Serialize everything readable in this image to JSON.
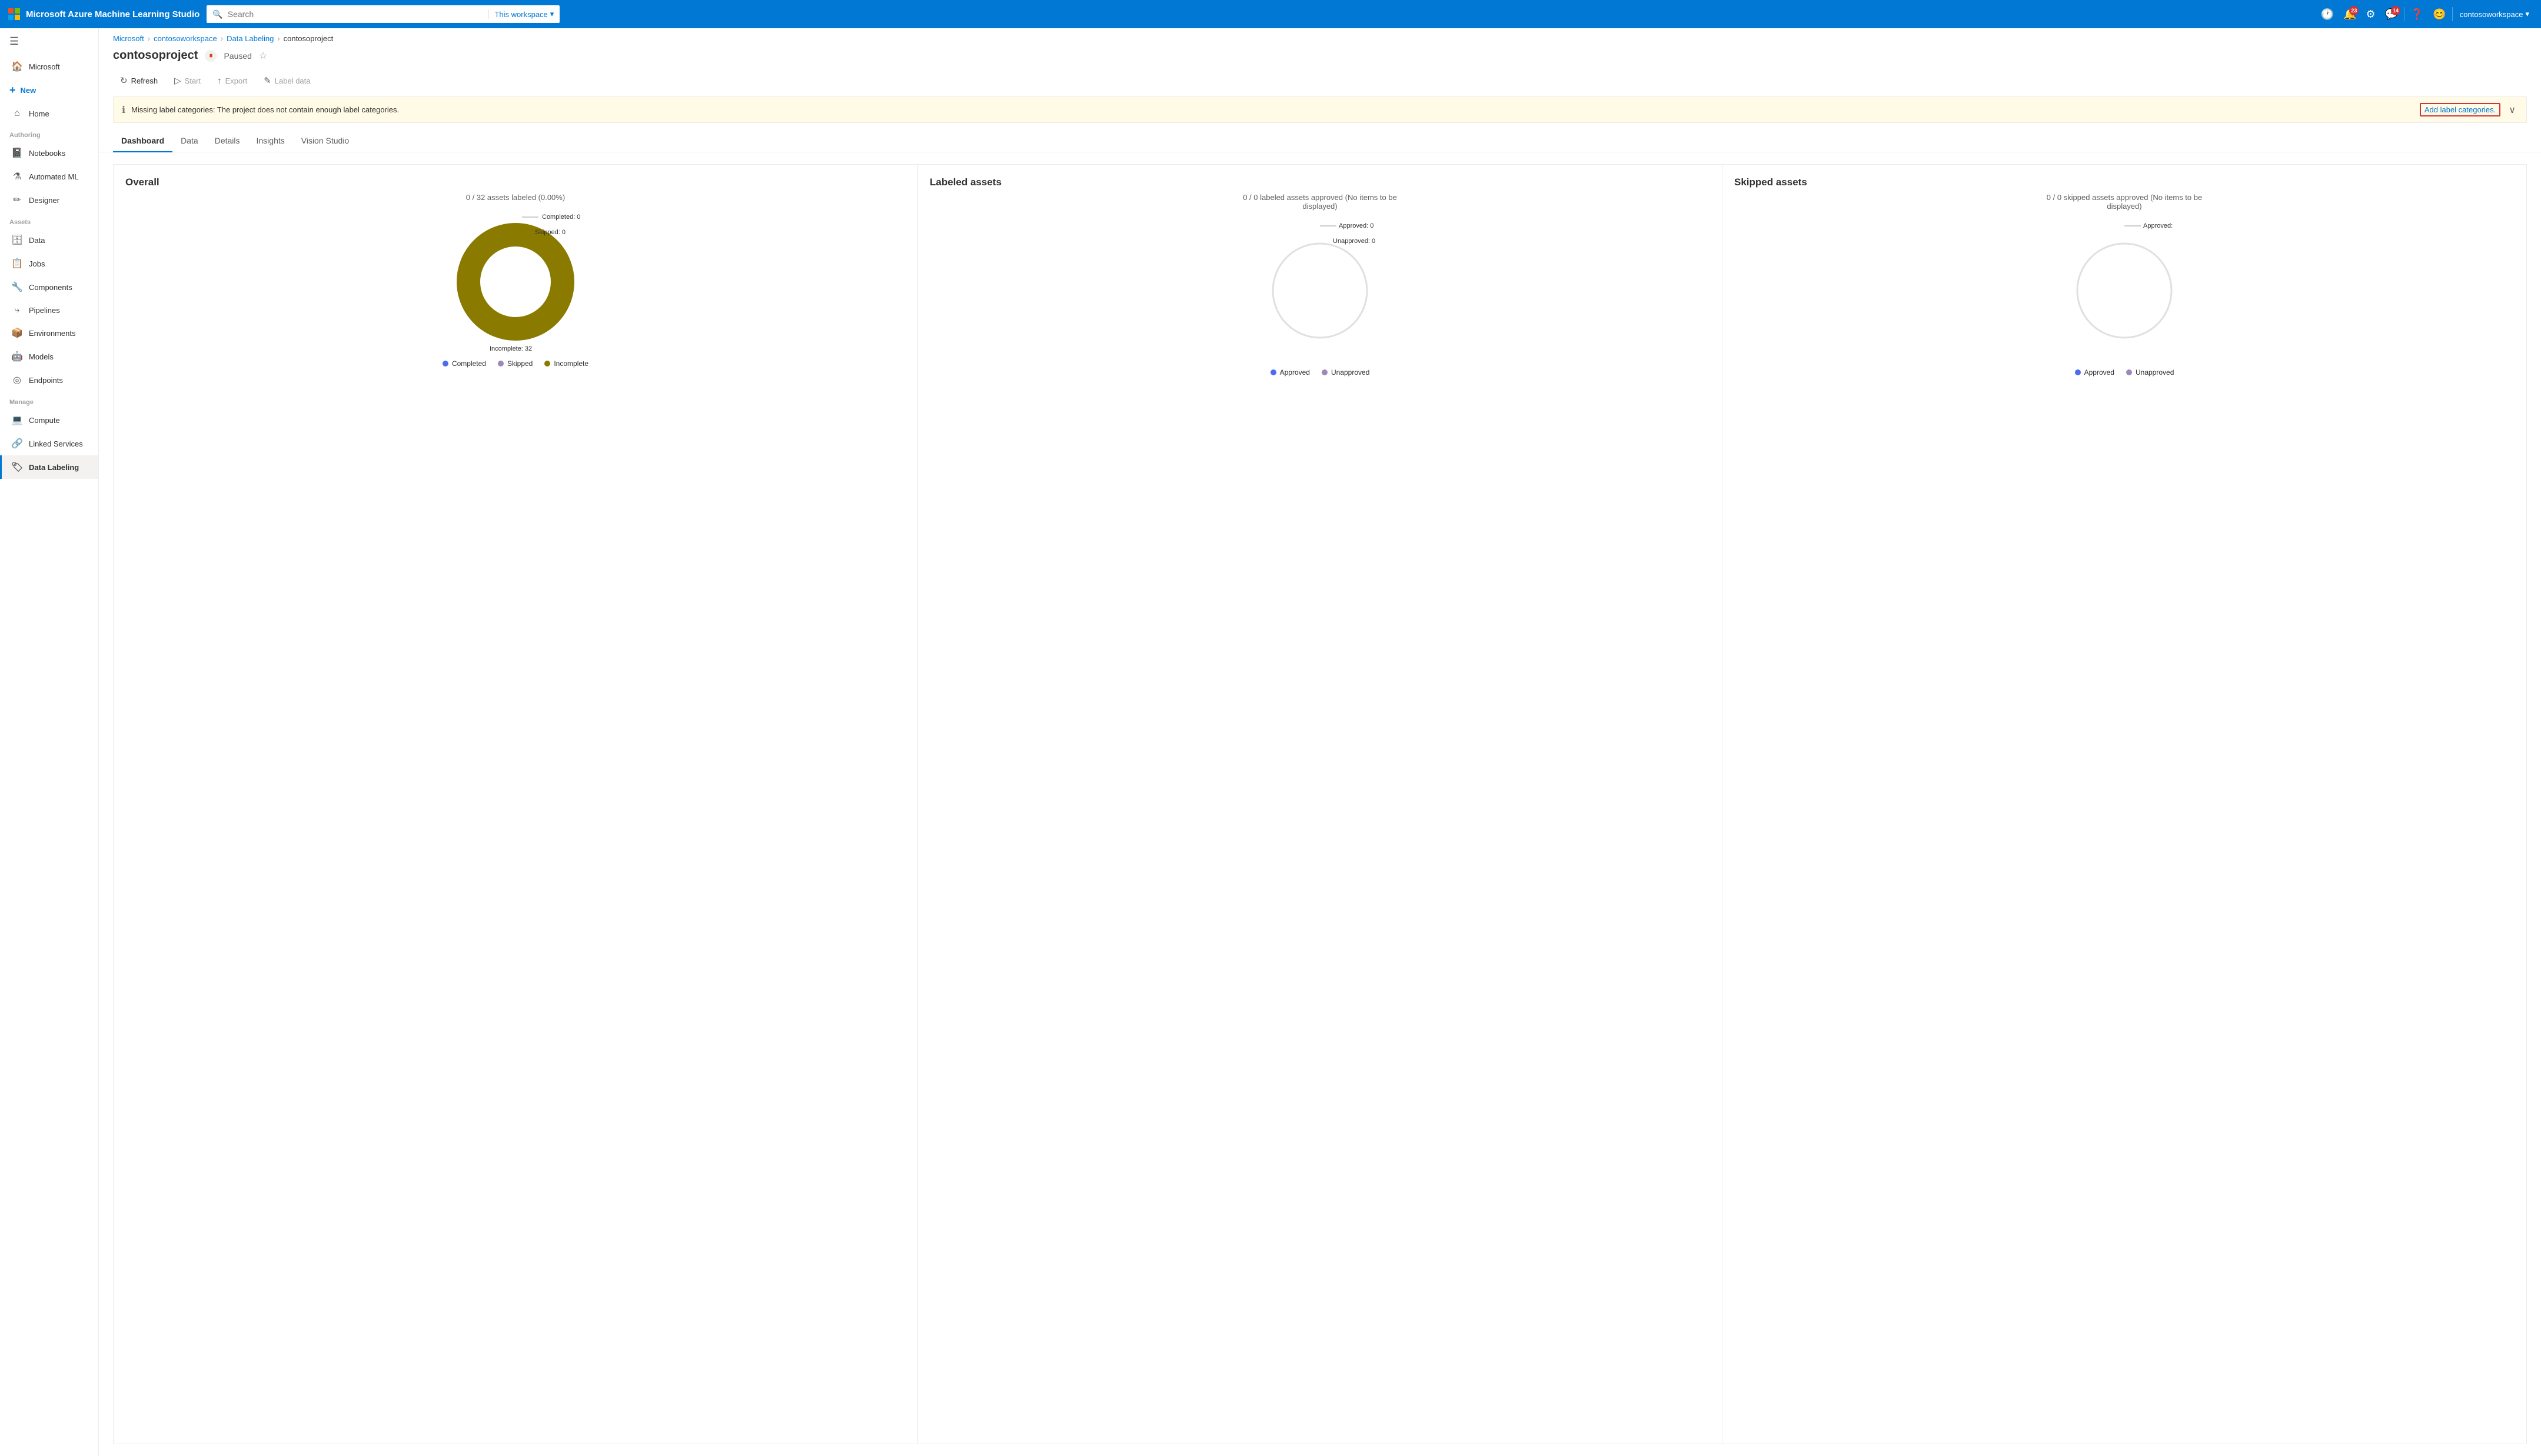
{
  "topbar": {
    "brand": "Microsoft Azure Machine Learning Studio",
    "search_placeholder": "Search",
    "search_scope": "This workspace",
    "user": "contosoworkspace",
    "notifications_count": "23",
    "feedback_count": "14"
  },
  "sidebar": {
    "hamburger_label": "Toggle navigation",
    "microsoft_label": "Microsoft",
    "new_label": "New",
    "home_label": "Home",
    "authoring_section": "Authoring",
    "notebooks_label": "Notebooks",
    "automated_ml_label": "Automated ML",
    "designer_label": "Designer",
    "assets_section": "Assets",
    "data_label": "Data",
    "jobs_label": "Jobs",
    "components_label": "Components",
    "pipelines_label": "Pipelines",
    "environments_label": "Environments",
    "models_label": "Models",
    "endpoints_label": "Endpoints",
    "manage_section": "Manage",
    "compute_label": "Compute",
    "linked_services_label": "Linked Services",
    "data_labeling_label": "Data Labeling"
  },
  "breadcrumb": {
    "microsoft": "Microsoft",
    "workspace": "contosoworkspace",
    "data_labeling": "Data Labeling",
    "project": "contosoproject"
  },
  "header": {
    "title": "contosoproject",
    "status": "Paused"
  },
  "toolbar": {
    "refresh": "Refresh",
    "start": "Start",
    "export": "Export",
    "label_data": "Label data"
  },
  "alert": {
    "message": "Missing label categories: The project does not contain enough label categories.",
    "link_text": "Add label categories.",
    "close_label": "Close alert"
  },
  "tabs": [
    {
      "id": "dashboard",
      "label": "Dashboard",
      "active": true
    },
    {
      "id": "data",
      "label": "Data",
      "active": false
    },
    {
      "id": "details",
      "label": "Details",
      "active": false
    },
    {
      "id": "insights",
      "label": "Insights",
      "active": false
    },
    {
      "id": "vision_studio",
      "label": "Vision Studio",
      "active": false
    }
  ],
  "charts": {
    "overall": {
      "title": "Overall",
      "subtitle": "0 / 32 assets labeled (0.00%)",
      "annotations": {
        "completed": "Completed: 0",
        "skipped": "Skipped: 0",
        "incomplete": "Incomplete: 32"
      },
      "legend": [
        {
          "label": "Completed",
          "color": "#4f6bed"
        },
        {
          "label": "Skipped",
          "color": "#9c89b8"
        },
        {
          "label": "Incomplete",
          "color": "#8b7a00"
        }
      ],
      "donut_color": "#8b7a00",
      "donut_bg": "#e0e0e0"
    },
    "labeled_assets": {
      "title": "Labeled assets",
      "subtitle": "0 / 0 labeled assets approved (No items to be displayed)",
      "annotations": {
        "approved": "Approved: 0",
        "unapproved": "Unapproved: 0"
      },
      "legend": [
        {
          "label": "Approved",
          "color": "#4f6bed"
        },
        {
          "label": "Unapproved",
          "color": "#9c89b8"
        }
      ],
      "donut_color": "#e0e0e0",
      "donut_bg": "#e0e0e0"
    },
    "skipped_assets": {
      "title": "Skipped assets",
      "subtitle": "0 / 0 skipped assets approved (No items to be displayed)",
      "annotations": {
        "approved": "Approved:"
      },
      "legend": [
        {
          "label": "Approved",
          "color": "#4f6bed"
        },
        {
          "label": "Unapproved",
          "color": "#9c89b8"
        }
      ],
      "donut_color": "#e0e0e0",
      "donut_bg": "#e0e0e0"
    }
  }
}
